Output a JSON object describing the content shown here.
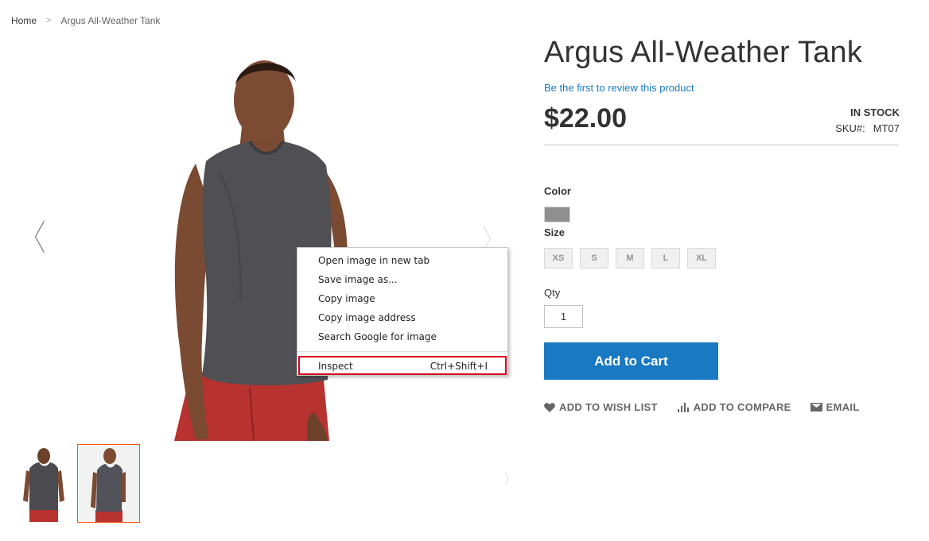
{
  "breadcrumb": {
    "home": "Home",
    "separator": ">",
    "current": "Argus All-Weather Tank"
  },
  "gallery": {
    "prev_icon": "chevron-left-icon",
    "next_icon": "chevron-right-icon",
    "thumbnails": [
      {
        "name": "thumb-front",
        "active": false
      },
      {
        "name": "thumb-front-2",
        "active": true
      }
    ],
    "active_border_color": "#ff5501"
  },
  "context_menu": {
    "items": [
      {
        "label": "Open image in new tab"
      },
      {
        "label": "Save image as..."
      },
      {
        "label": "Copy image"
      },
      {
        "label": "Copy image address"
      },
      {
        "label": "Search Google for image"
      }
    ],
    "inspect": {
      "label": "Inspect",
      "shortcut": "Ctrl+Shift+I"
    },
    "highlight_color": "#d9001b"
  },
  "product": {
    "title": "Argus All-Weather Tank",
    "review_link": "Be the first to review this product",
    "price": "$22.00",
    "stock": "IN STOCK",
    "sku_label": "SKU#:",
    "sku_value": "MT07",
    "color_label": "Color",
    "color_swatch": "#8f8f8f",
    "size_label": "Size",
    "sizes": [
      "XS",
      "S",
      "M",
      "L",
      "XL"
    ],
    "qty_label": "Qty",
    "qty_value": "1",
    "add_to_cart": "Add to Cart",
    "actions": {
      "wishlist": "ADD TO WISH LIST",
      "compare": "ADD TO COMPARE",
      "email": "EMAIL"
    }
  },
  "colors": {
    "primary": "#1979c3",
    "link": "#1979c3"
  }
}
